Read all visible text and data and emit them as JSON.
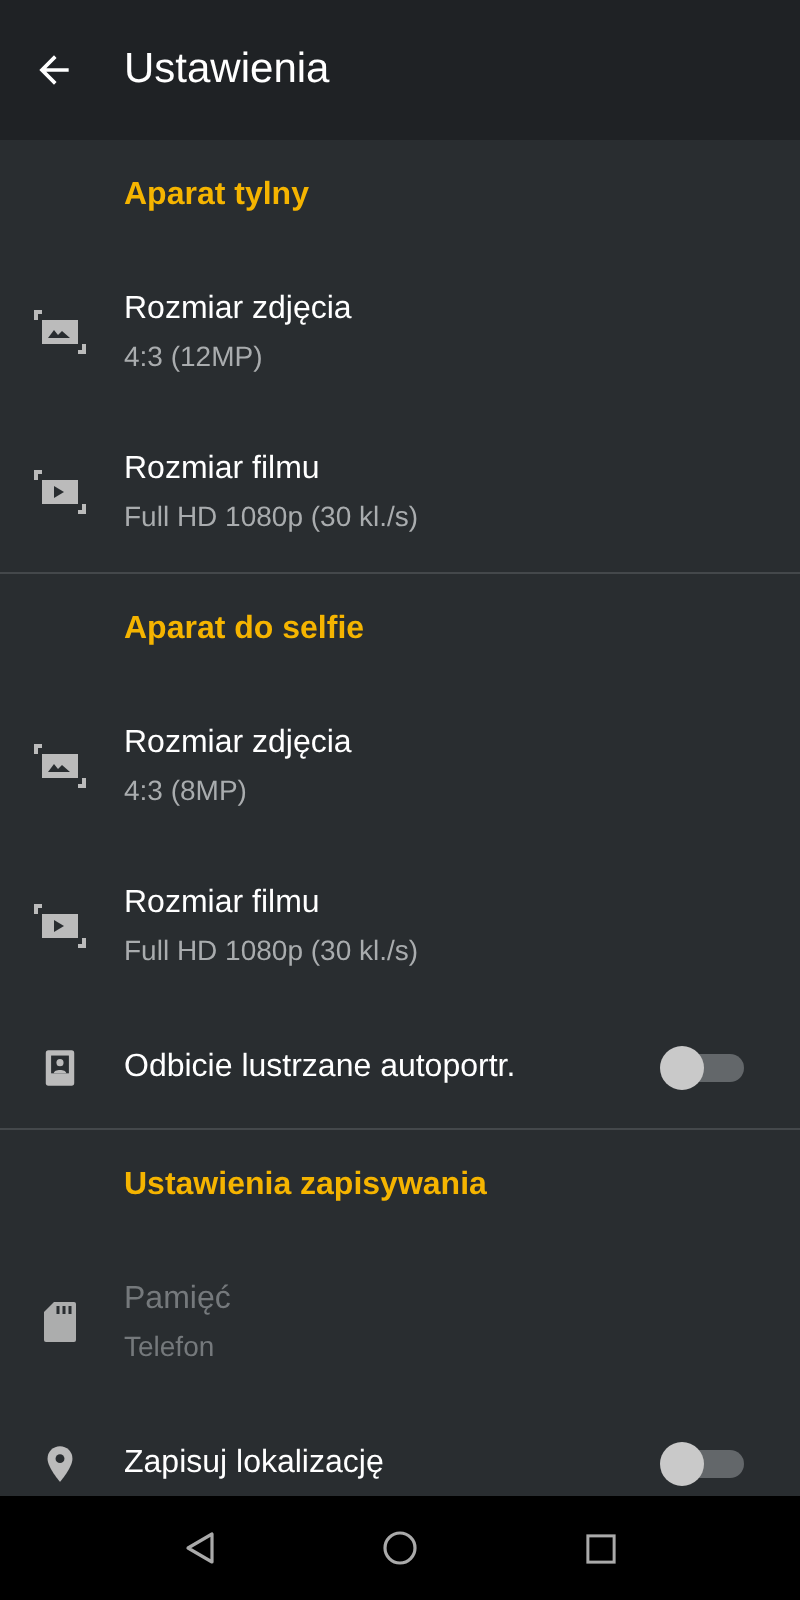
{
  "app_bar": {
    "title": "Ustawienia"
  },
  "sections": [
    {
      "title": "Aparat tylny",
      "rows": [
        {
          "kind": "photo",
          "title": "Rozmiar zdjęcia",
          "value": "4:3 (12MP)",
          "disabled": false
        },
        {
          "kind": "video",
          "title": "Rozmiar filmu",
          "value": "Full HD 1080p (30 kl./s)",
          "disabled": false
        }
      ]
    },
    {
      "title": "Aparat do selfie",
      "rows": [
        {
          "kind": "photo",
          "title": "Rozmiar zdjęcia",
          "value": "4:3 (8MP)",
          "disabled": false
        },
        {
          "kind": "video",
          "title": "Rozmiar filmu",
          "value": "Full HD 1080p (30 kl./s)",
          "disabled": false
        },
        {
          "kind": "mirror",
          "title": "Odbicie lustrzane autoportr.",
          "on": false,
          "disabled": false
        }
      ]
    },
    {
      "title": "Ustawienia zapisywania",
      "rows": [
        {
          "kind": "storage",
          "title": "Pamięć",
          "value": "Telefon",
          "disabled": true
        },
        {
          "kind": "location",
          "title": "Zapisuj lokalizację",
          "on": false,
          "disabled": false
        }
      ]
    }
  ]
}
